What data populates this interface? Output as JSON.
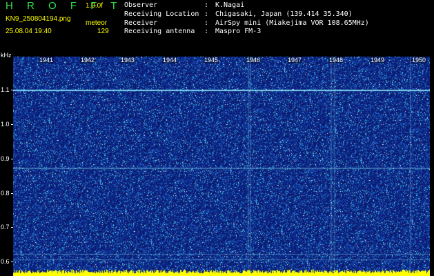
{
  "header": {
    "app_name": "H R O F F T",
    "version": "1.0.0f",
    "file_name": "KN9_250804194.png",
    "mode": "meteor",
    "datetime": "25.08.04 19:40",
    "count": "129",
    "info": [
      {
        "key": "Observer",
        "value": "K.Nagai"
      },
      {
        "key": "Receiving Location",
        "value": "Chigasaki, Japan (139.414 35.340)"
      },
      {
        "key": "Receiver",
        "value": "AirSpy mini (Miakejima VOR 108.65MHz)"
      },
      {
        "key": "Receiving antenna",
        "value": "Maspro FM-3"
      }
    ]
  },
  "plot": {
    "unit_label": "kHz",
    "y_labels": [
      "1.1",
      "1.0",
      "0.9",
      "0.8",
      "0.7",
      "0.6"
    ],
    "minute_labels": [
      "1941",
      "1942",
      "1943",
      "1944",
      "1945",
      "1946",
      "1947",
      "1948",
      "1949",
      "1950"
    ],
    "background_color": "#0a1a6e",
    "dot_color": "#3fd0ff",
    "carrier_color": "#8ff0ff",
    "bottom_bar_color": "#ffff00"
  }
}
